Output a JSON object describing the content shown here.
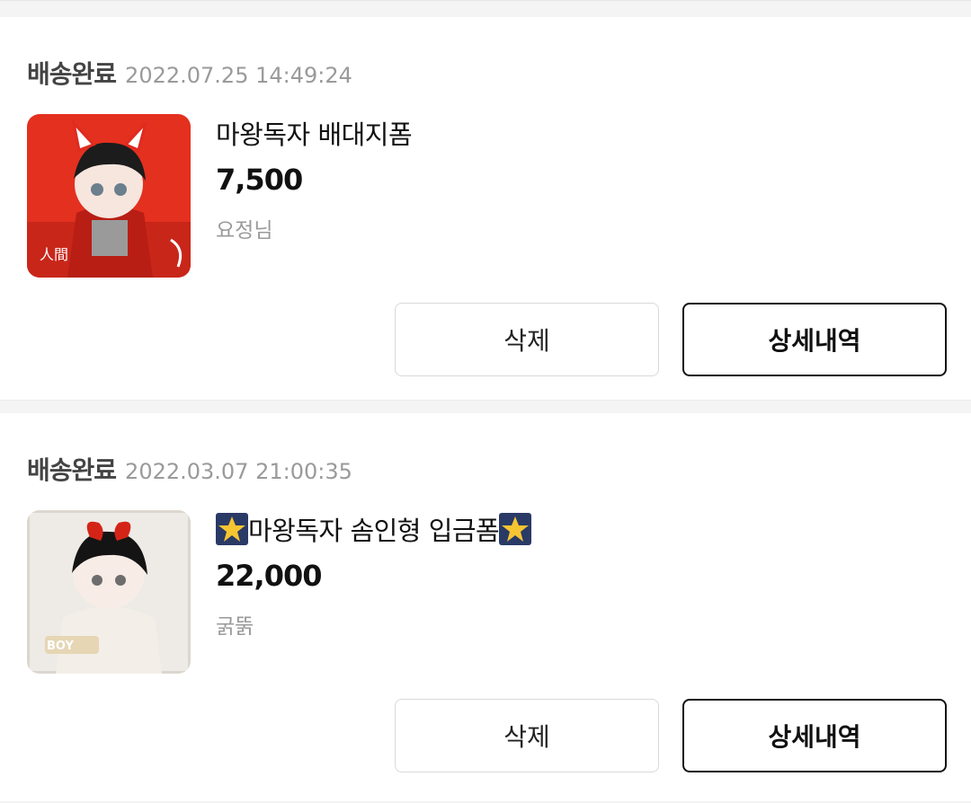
{
  "orders": [
    {
      "status": "배송완료",
      "date": "2022.07.25 14:49:24",
      "title": "마왕독자 배대지폼",
      "price": "7,500",
      "seller": "요정님",
      "delete_label": "삭제",
      "detail_label": "상세내역"
    },
    {
      "status": "배송완료",
      "date": "2022.03.07 21:00:35",
      "title": "마왕독자 솜인형 입금폼",
      "price": "22,000",
      "seller": "굵뚥",
      "delete_label": "삭제",
      "detail_label": "상세내역"
    }
  ]
}
